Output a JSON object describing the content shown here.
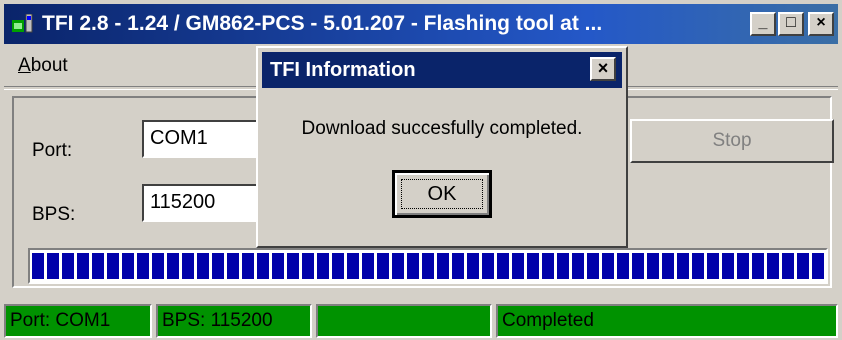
{
  "window": {
    "title": "TFI 2.8 - 1.24 / GM862-PCS - 5.01.207 - Flashing tool at ...",
    "controls": {
      "minimize": "_",
      "maximize": "□",
      "close": "×"
    }
  },
  "menu": {
    "about_first": "A",
    "about_rest": "bout"
  },
  "form": {
    "port_label": "Port:",
    "port_value": "COM1",
    "bps_label": "BPS:",
    "bps_value": "115200",
    "stop_label": "Stop"
  },
  "progress": {
    "value": 1.0
  },
  "status": {
    "port": "Port: COM1",
    "bps": "BPS: 115200",
    "empty": "",
    "state": "Completed",
    "color": "#009200"
  },
  "dialog": {
    "title": "TFI Information",
    "close": "×",
    "message": "Download succesfully completed.",
    "ok_label": "OK"
  },
  "colors": {
    "titlebar": "#0a246a",
    "face": "#d4d0c8",
    "progress": "#0000aa"
  }
}
